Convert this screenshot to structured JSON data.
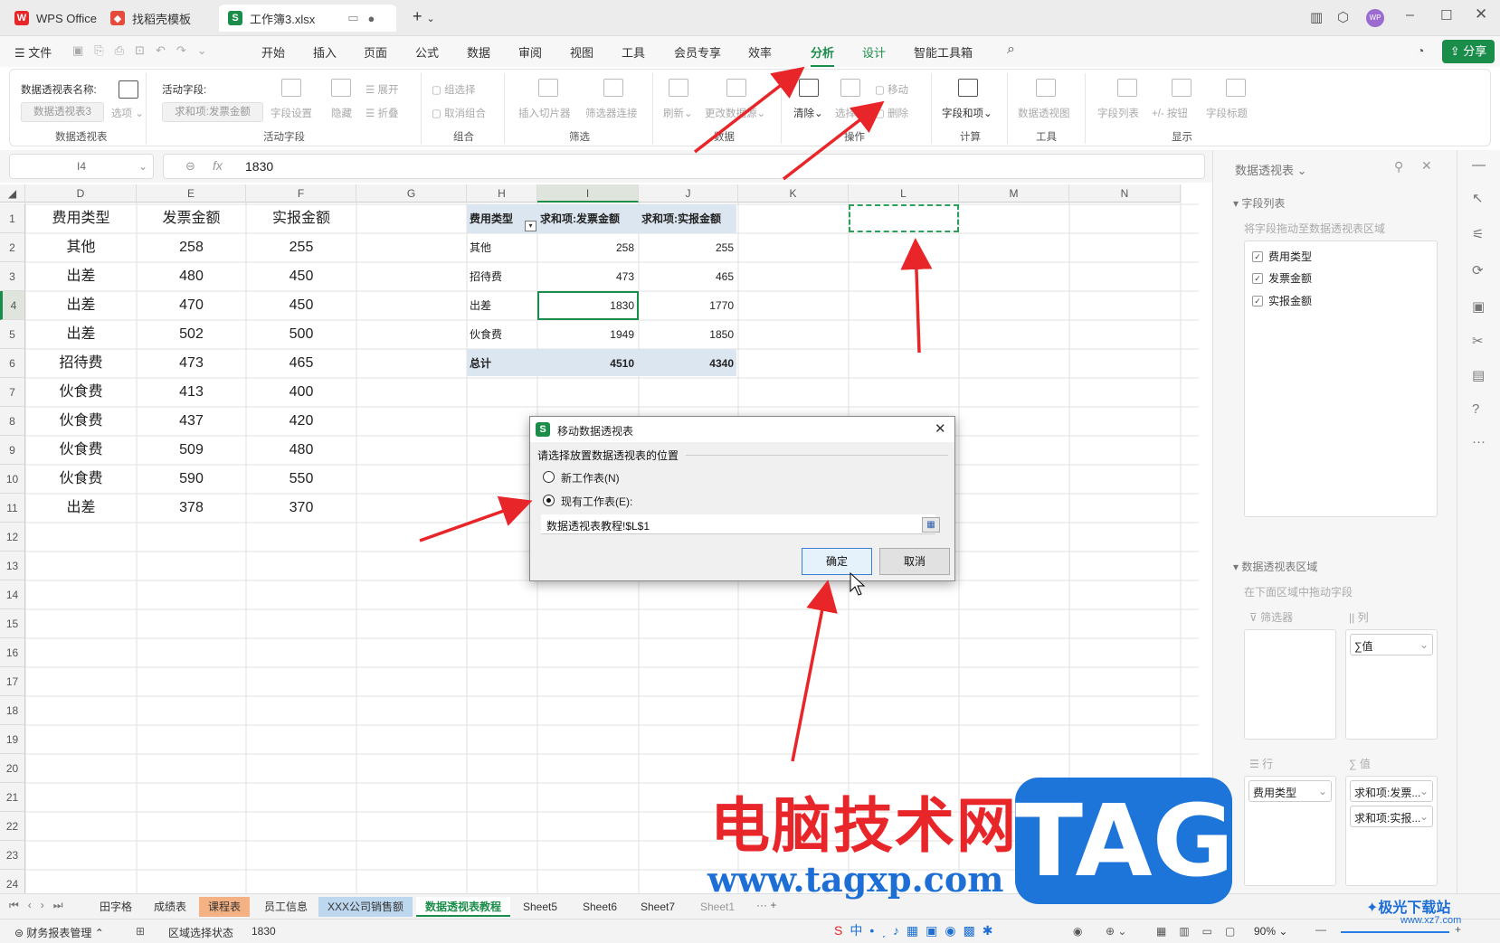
{
  "titlebar": {
    "tabs": [
      "WPS Office",
      "找稻壳模板",
      "工作簿3.xlsx"
    ]
  },
  "menu": {
    "file": "文件",
    "items": [
      "开始",
      "插入",
      "页面",
      "公式",
      "数据",
      "审阅",
      "视图",
      "工具",
      "会员专享",
      "效率",
      "分析",
      "设计",
      "智能工具箱"
    ],
    "share": "分享"
  },
  "ribbon": {
    "pivot_name_label": "数据透视表名称:",
    "pivot_name_value": "数据透视表3",
    "options": "选项",
    "active_field_label": "活动字段:",
    "active_field_value": "求和项:发票金额",
    "field_settings": "字段设置",
    "hide": "隐藏",
    "expand": "展开",
    "collapse": "折叠",
    "group_select": "组选择",
    "ungroup": "取消组合",
    "insert_slicer": "插入切片器",
    "filter_conn": "筛选器连接",
    "refresh": "刷新",
    "change_source": "更改数据源",
    "clear": "清除",
    "select": "选择",
    "move": "移动",
    "delete": "删除",
    "fields_items": "字段和项",
    "pivot_chart": "数据透视图",
    "field_list": "字段列表",
    "plus_minus": "+/- 按钮",
    "field_headers": "字段标题",
    "groups": [
      "数据透视表",
      "活动字段",
      "组合",
      "筛选",
      "数据",
      "操作",
      "计算",
      "工具",
      "显示"
    ]
  },
  "formula": {
    "namebox": "I4",
    "fx": "fx",
    "value": "1830"
  },
  "columns": [
    "D",
    "E",
    "F",
    "G",
    "H",
    "I",
    "J",
    "K",
    "L",
    "M",
    "N"
  ],
  "rows": [
    "1",
    "2",
    "3",
    "4",
    "5",
    "6",
    "7",
    "8",
    "9",
    "10",
    "11",
    "12",
    "13",
    "14",
    "15",
    "16",
    "17",
    "18",
    "19",
    "20",
    "21",
    "22",
    "23",
    "24"
  ],
  "table": [
    [
      "费用类型",
      "发票金额",
      "实报金额"
    ],
    [
      "其他",
      "258",
      "255"
    ],
    [
      "出差",
      "480",
      "450"
    ],
    [
      "出差",
      "470",
      "450"
    ],
    [
      "出差",
      "502",
      "500"
    ],
    [
      "招待费",
      "473",
      "465"
    ],
    [
      "伙食费",
      "413",
      "400"
    ],
    [
      "伙食费",
      "437",
      "420"
    ],
    [
      "伙食费",
      "509",
      "480"
    ],
    [
      "伙食费",
      "590",
      "550"
    ],
    [
      "出差",
      "378",
      "370"
    ]
  ],
  "pivot": {
    "headers": [
      "费用类型",
      "求和项:发票金额",
      "求和项:实报金额"
    ],
    "rows": [
      [
        "其他",
        "258",
        "255"
      ],
      [
        "招待费",
        "473",
        "465"
      ],
      [
        "出差",
        "1830",
        "1770"
      ],
      [
        "伙食费",
        "1949",
        "1850"
      ]
    ],
    "total": [
      "总计",
      "4510",
      "4340"
    ]
  },
  "dialog": {
    "title": "移动数据透视表",
    "prompt": "请选择放置数据透视表的位置",
    "opt_new": "新工作表(N)",
    "opt_existing": "现有工作表(E):",
    "range": "数据透视表教程!$L$1",
    "ok": "确定",
    "cancel": "取消"
  },
  "panel": {
    "title": "数据透视表",
    "field_list": "字段列表",
    "drag_hint": "将字段拖动至数据透视表区域",
    "fields": [
      "费用类型",
      "发票金额",
      "实报金额"
    ],
    "area_title": "数据透视表区域",
    "area_hint": "在下面区域中拖动字段",
    "filters": "筛选器",
    "columns": "列",
    "rows": "行",
    "values": "值",
    "col_item": "∑值",
    "row_item": "费用类型",
    "val_items": [
      "求和项:发票...",
      "求和项:实报..."
    ]
  },
  "sheets": [
    "田字格",
    "成绩表",
    "课程表",
    "员工信息",
    "XXX公司销售额",
    "数据透视表教程",
    "Sheet5",
    "Sheet6",
    "Sheet7",
    "Sheet1"
  ],
  "status": {
    "finance": "财务报表管理",
    "mode": "区域选择状态",
    "value": "1830",
    "zoom": "90%"
  },
  "watermark": {
    "cn": "电脑技术网",
    "url": "www.tagxp.com",
    "tag": "TAG",
    "site": "极光下载站",
    "site_url": "www.xz7.com"
  },
  "colors": {
    "accent": "#1a8d4a",
    "arrow": "#e8262a"
  }
}
